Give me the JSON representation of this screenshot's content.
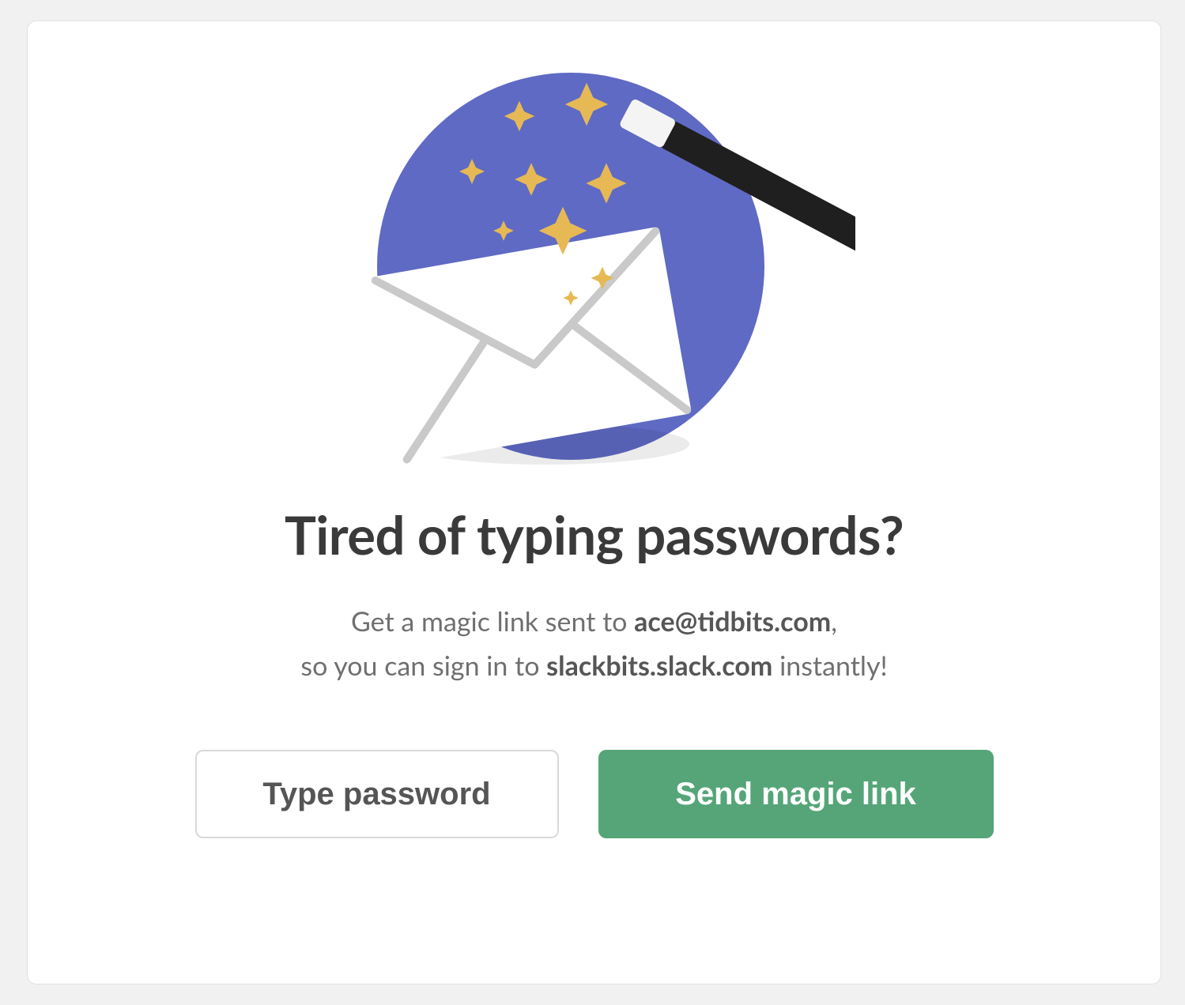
{
  "headline": "Tired of typing passwords?",
  "subtitle": {
    "line1_prefix": "Get a magic link sent to ",
    "email": "ace@tidbits.com",
    "line1_suffix": ",",
    "line2_prefix": "so you can sign in to ",
    "workspace": "slackbits.slack.com",
    "line2_suffix": " instantly!"
  },
  "buttons": {
    "type_password": "Type password",
    "send_magic_link": "Send magic link"
  },
  "colors": {
    "circle": "#5f6ac4",
    "sparkle": "#e6b955",
    "primary_button": "#55a578"
  }
}
